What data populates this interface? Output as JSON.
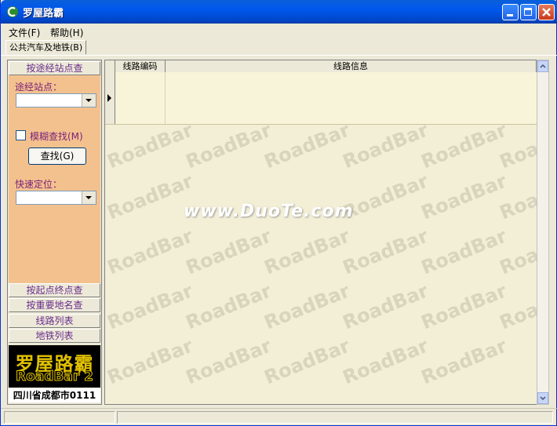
{
  "window": {
    "title": "罗屋路霸"
  },
  "menu": {
    "file": "文件(F)",
    "help": "帮助(H)"
  },
  "tab": {
    "label": "公共汽车及地铁(B)"
  },
  "left_panel": {
    "section1_button": "按途经站点查",
    "stop_label": "途经站点：",
    "fuzzy_label": "模糊查找(M)",
    "fuzzy_checked": false,
    "find_button": "查找(G)",
    "quick_locate_label": "快速定位：",
    "nav_buttons": [
      "按起点终点查",
      "按重要地名查",
      "线路列表",
      "地铁列表"
    ],
    "logo_cn": "罗屋路霸",
    "logo_en": "RoadBar 2",
    "city": "四川省成都市0111"
  },
  "grid": {
    "col1": "线路编码",
    "col2": "线路信息"
  },
  "watermark": {
    "text": "RoadBar",
    "site": "www.DuoTe.com"
  },
  "colors": {
    "titlebar": "#0058ee",
    "panel_orange": "#f3c18e",
    "grid_bg": "#f3efd6",
    "nav_text": "#6a2d8c"
  }
}
